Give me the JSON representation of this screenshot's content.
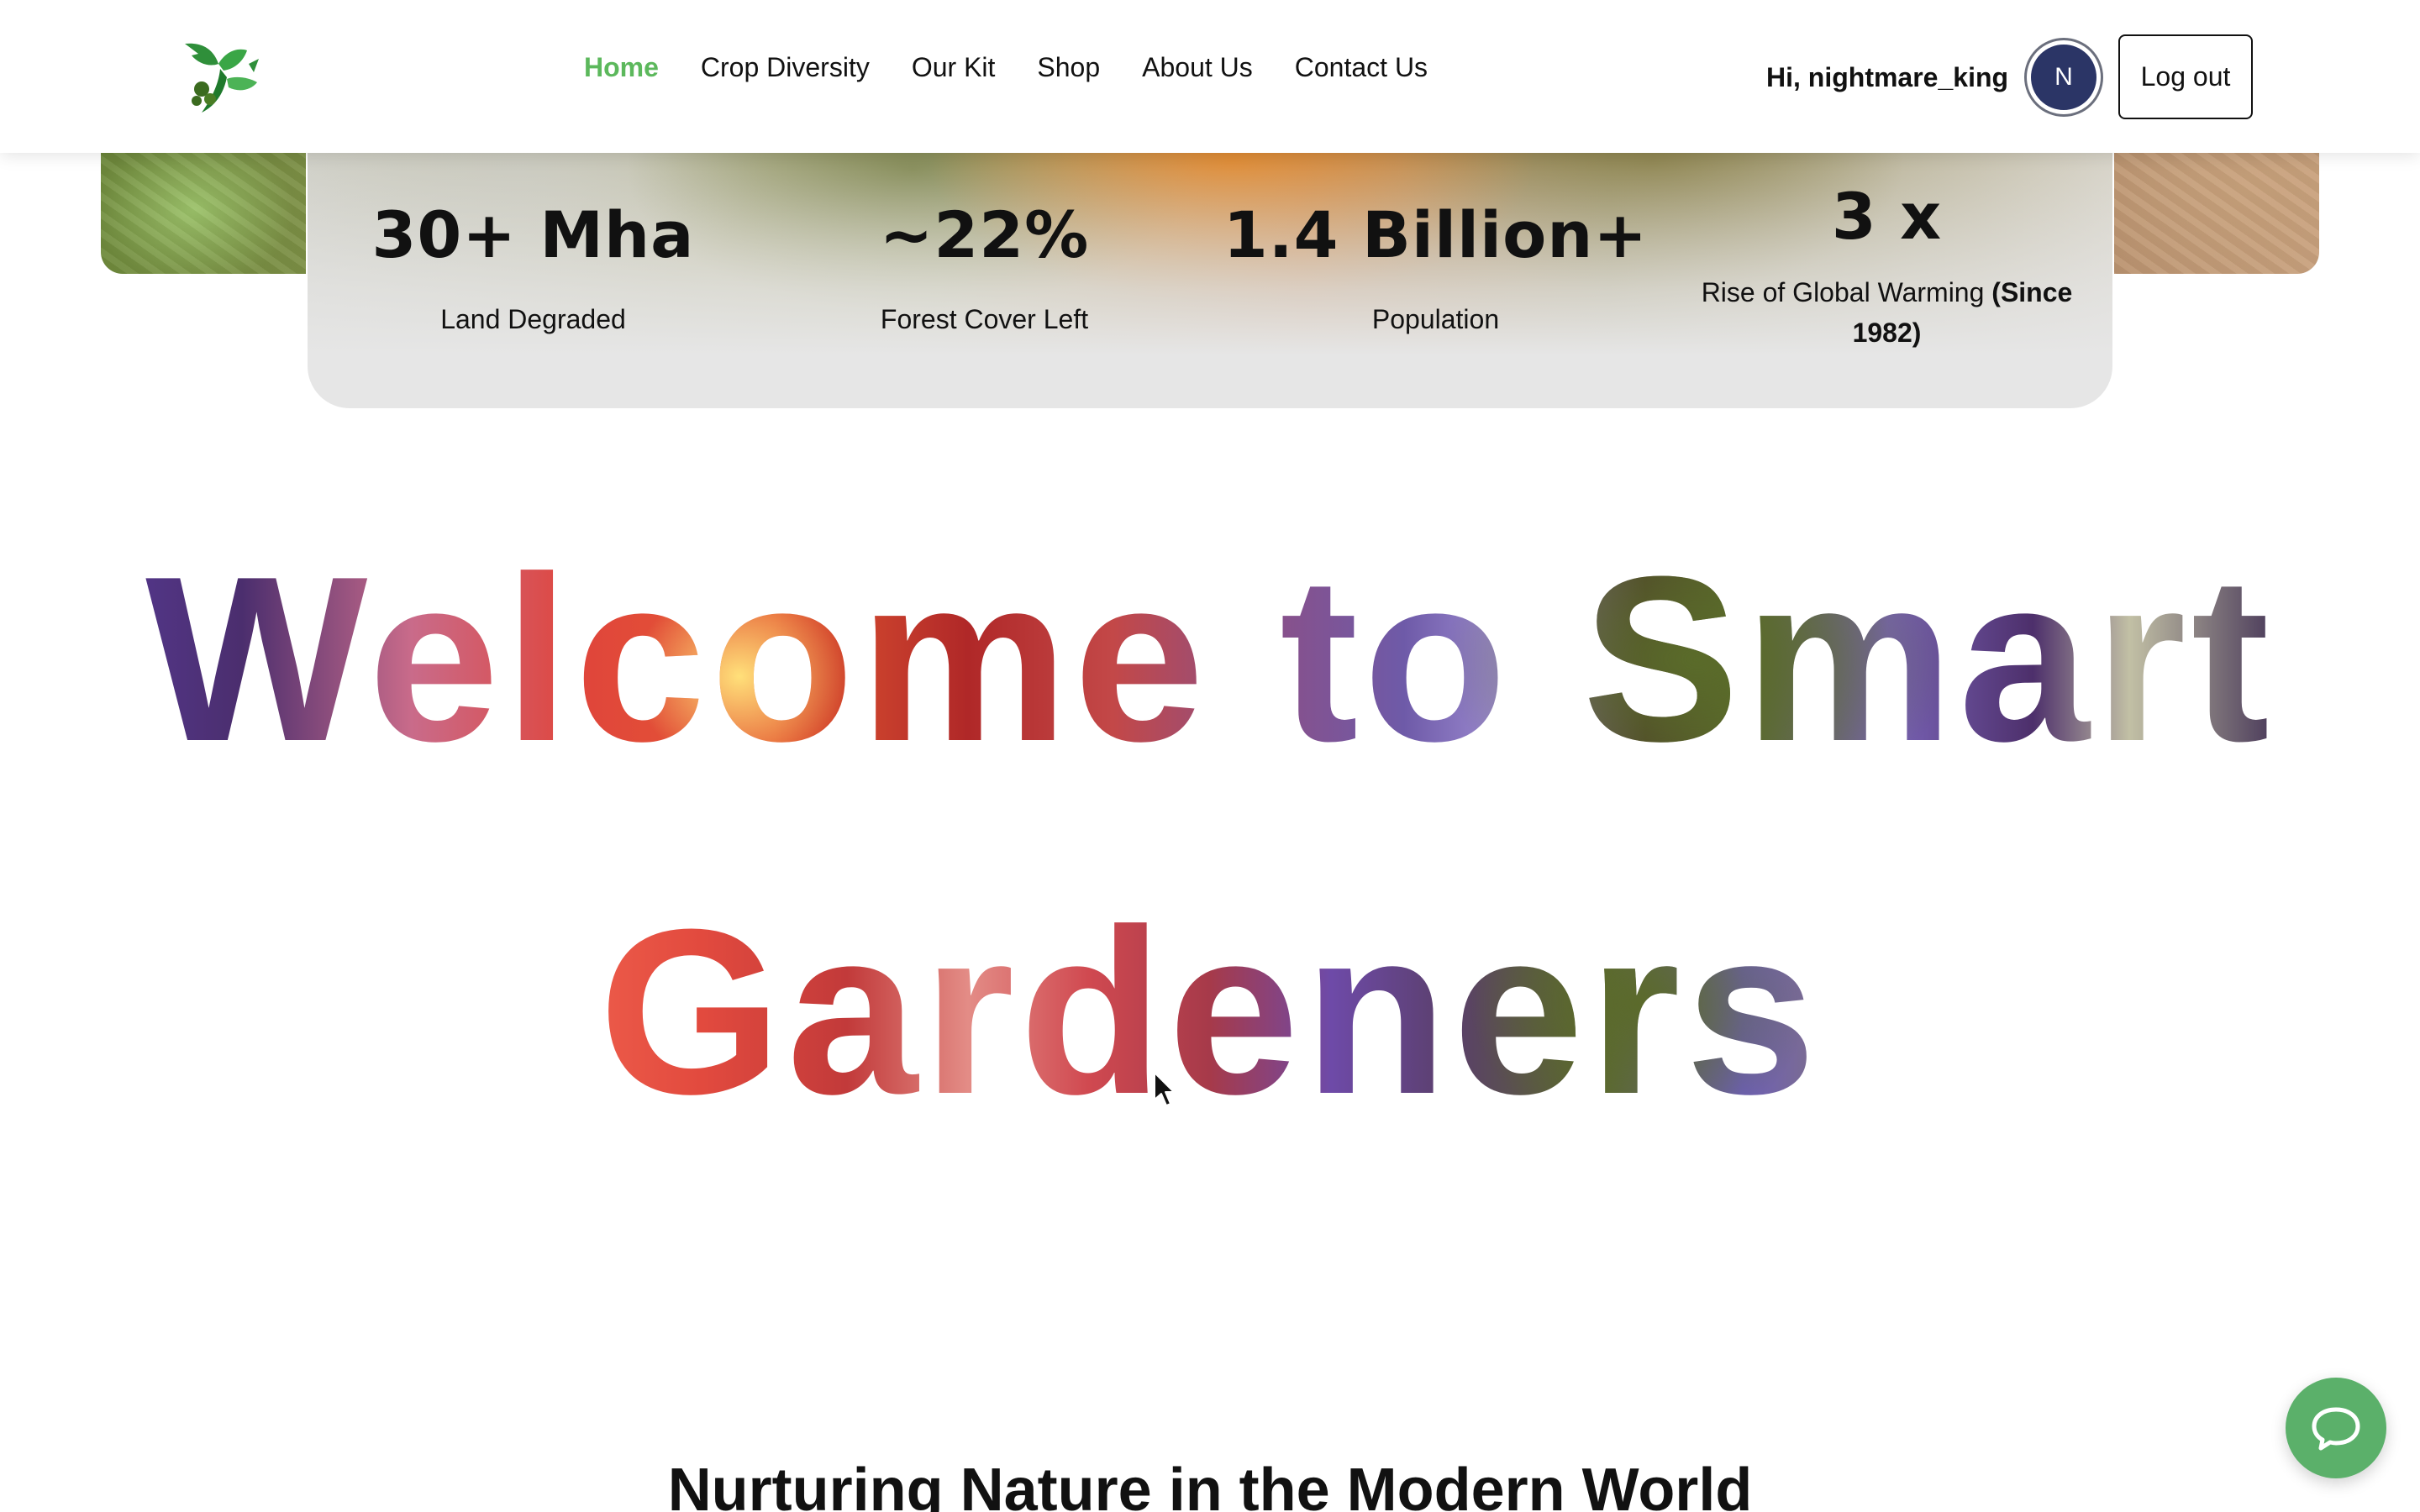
{
  "header": {
    "nav": [
      {
        "label": "Home",
        "active": true
      },
      {
        "label": "Crop Diversity",
        "active": false
      },
      {
        "label": "Our Kit",
        "active": false
      },
      {
        "label": "Shop",
        "active": false
      },
      {
        "label": "About Us",
        "active": false
      },
      {
        "label": "Contact Us",
        "active": false
      }
    ],
    "greeting": "Hi, nightmare_king",
    "avatar_initial": "N",
    "logout_label": "Log out"
  },
  "stats": [
    {
      "value": "30+ Mha",
      "label": "Land Degraded"
    },
    {
      "value": "~22%",
      "label": "Forest Cover Left"
    },
    {
      "value": "1.4 Billion+",
      "label": "Population"
    },
    {
      "value": "3 x",
      "label": "Rise of Global Warming",
      "label_bold": "(Since 1982)"
    }
  ],
  "hero": {
    "line1": "Welcome to Smart",
    "line2": "Gardeners",
    "subheading": "Nurturing Nature in the Modern World"
  },
  "icons": {
    "logo": "plant-sprout-logo",
    "chat": "chat-bubble-icon",
    "cursor": "mouse-pointer-icon"
  },
  "colors": {
    "accent": "#5cb85c",
    "avatar": "#2b3566",
    "chat_button": "#5bb06a"
  }
}
